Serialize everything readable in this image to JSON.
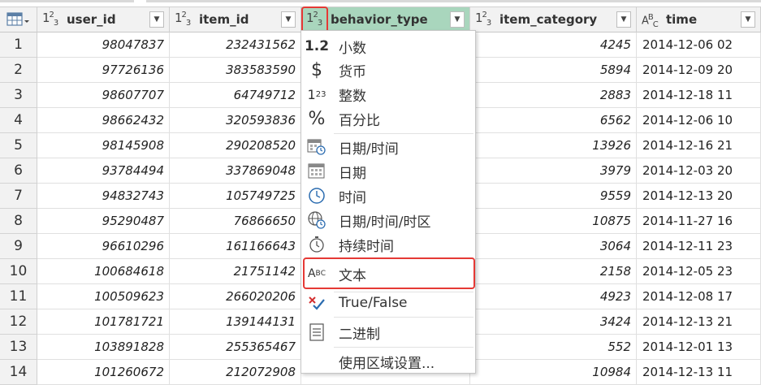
{
  "table": {
    "columns": [
      {
        "name": "user_id",
        "type_icon": "123"
      },
      {
        "name": "item_id",
        "type_icon": "123"
      },
      {
        "name": "behavior_type",
        "type_icon": "123"
      },
      {
        "name": "item_category",
        "type_icon": "123"
      },
      {
        "name": "time",
        "type_icon": "ABC"
      }
    ],
    "rows": [
      {
        "n": "1",
        "user_id": "98047837",
        "item_id": "232431562",
        "item_category": "4245",
        "time": "2014-12-06 02"
      },
      {
        "n": "2",
        "user_id": "97726136",
        "item_id": "383583590",
        "item_category": "5894",
        "time": "2014-12-09 20"
      },
      {
        "n": "3",
        "user_id": "98607707",
        "item_id": "64749712",
        "item_category": "2883",
        "time": "2014-12-18 11"
      },
      {
        "n": "4",
        "user_id": "98662432",
        "item_id": "320593836",
        "item_category": "6562",
        "time": "2014-12-06 10"
      },
      {
        "n": "5",
        "user_id": "98145908",
        "item_id": "290208520",
        "item_category": "13926",
        "time": "2014-12-16 21"
      },
      {
        "n": "6",
        "user_id": "93784494",
        "item_id": "337869048",
        "item_category": "3979",
        "time": "2014-12-03 20"
      },
      {
        "n": "7",
        "user_id": "94832743",
        "item_id": "105749725",
        "item_category": "9559",
        "time": "2014-12-13 20"
      },
      {
        "n": "8",
        "user_id": "95290487",
        "item_id": "76866650",
        "item_category": "10875",
        "time": "2014-11-27 16"
      },
      {
        "n": "9",
        "user_id": "96610296",
        "item_id": "161166643",
        "item_category": "3064",
        "time": "2014-12-11 23"
      },
      {
        "n": "10",
        "user_id": "100684618",
        "item_id": "21751142",
        "item_category": "2158",
        "time": "2014-12-05 23"
      },
      {
        "n": "11",
        "user_id": "100509623",
        "item_id": "266020206",
        "item_category": "4923",
        "time": "2014-12-08 17"
      },
      {
        "n": "12",
        "user_id": "101781721",
        "item_id": "139144131",
        "item_category": "3424",
        "time": "2014-12-13 21"
      },
      {
        "n": "13",
        "user_id": "103891828",
        "item_id": "255365467",
        "item_category": "552",
        "time": "2014-12-01 13"
      },
      {
        "n": "14",
        "user_id": "101260672",
        "item_id": "212072908",
        "item_category": "10984",
        "time": "2014-12-13 11"
      }
    ]
  },
  "type_menu": {
    "items": [
      {
        "icon": "decimal-icon",
        "glyph": "1.2",
        "label": "小数"
      },
      {
        "icon": "currency-icon",
        "glyph": "$",
        "label": "货币"
      },
      {
        "icon": "whole-number-icon",
        "glyph": "123",
        "label": "整数"
      },
      {
        "icon": "percent-icon",
        "glyph": "%",
        "label": "百分比"
      },
      {
        "icon": "datetime-icon",
        "glyph": "",
        "label": "日期/时间"
      },
      {
        "icon": "date-icon",
        "glyph": "",
        "label": "日期"
      },
      {
        "icon": "time-icon",
        "glyph": "",
        "label": "时间"
      },
      {
        "icon": "datetime-zone-icon",
        "glyph": "",
        "label": "日期/时间/时区"
      },
      {
        "icon": "duration-icon",
        "glyph": "",
        "label": "持续时间"
      },
      {
        "icon": "text-icon",
        "glyph": "ABC",
        "label": "文本",
        "highlighted": true
      },
      {
        "icon": "true-false-icon",
        "glyph": "",
        "label": "True/False"
      },
      {
        "icon": "binary-icon",
        "glyph": "",
        "label": "二进制"
      },
      {
        "icon": "",
        "glyph": "",
        "label": "使用区域设置..."
      }
    ]
  },
  "colors": {
    "selected_header": "#a9d6bd",
    "highlight_border": "#e53935",
    "header_bg": "#f2f2f2"
  }
}
